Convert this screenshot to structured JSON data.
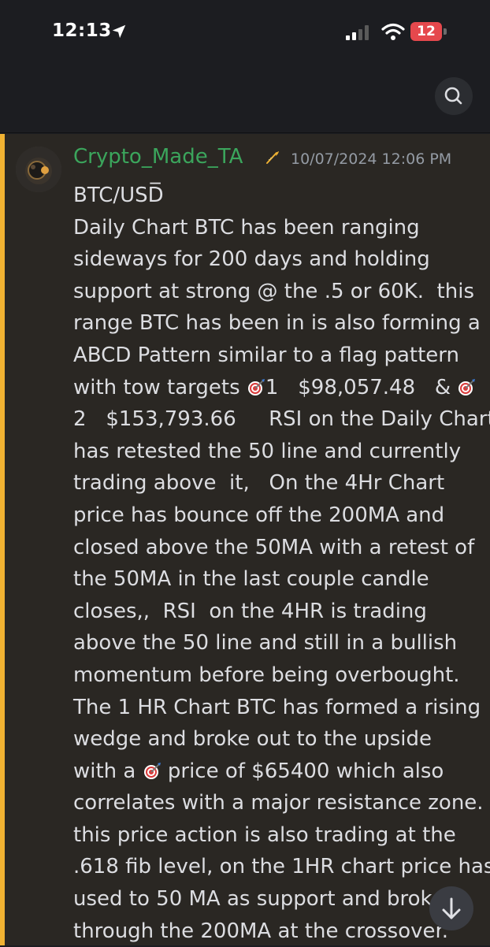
{
  "status_bar": {
    "time": "12:13",
    "battery": "12"
  },
  "message": {
    "username": "Crypto_Made_TA",
    "timestamp": "10/07/2024 12:06 PM",
    "lines": [
      "BTC/USD̅",
      "Daily Chart BTC has been ranging",
      "sideways for 200 days and holding",
      "support at strong @ the .5 or 60K.  this",
      "range BTC has been in is also forming a",
      "ABCD Pattern similar to a flag pattern",
      [
        "with tow targets ",
        "1   $98,057.48   & "
      ],
      "2   $153,793.66     RSI on the Daily Chart",
      "has retested the 50 line and currently",
      "trading above  it,   On the 4Hr Chart",
      "price has bounce off the 200MA and",
      "closed above the 50MA with a retest of",
      "the 50MA in the last couple candle",
      "closes,,  RSI  on the 4HR is trading",
      "above the 50 line and still in a bullish",
      "momentum before being overbought.",
      "The 1 HR Chart BTC has formed a rising",
      "wedge and broke out to the upside",
      [
        "with a ",
        " price of $65400 which also"
      ],
      "correlates with a major resistance zone.",
      "this price action is also trading at the",
      ".618 fib level, on the 1HR chart price has",
      "used to 50 MA as support and broke",
      "through the 200MA at the crossover."
    ]
  }
}
